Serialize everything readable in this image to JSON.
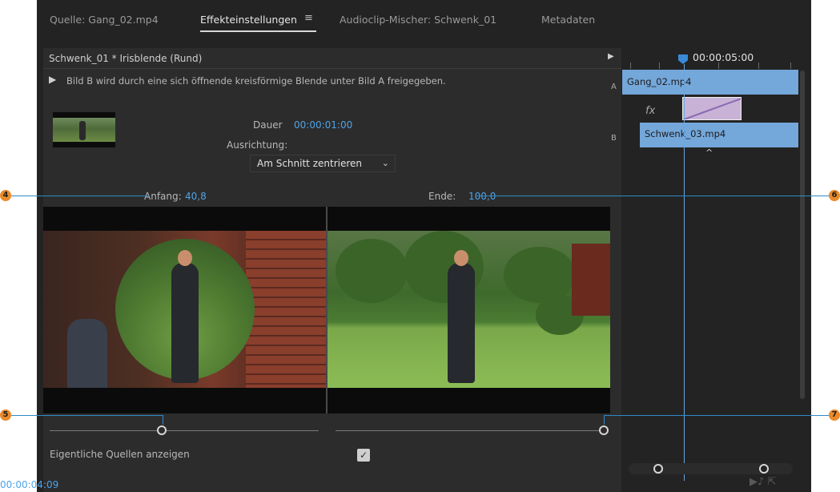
{
  "tabs": [
    {
      "label": "Quelle: Gang_02.mp4",
      "active": false
    },
    {
      "label": "Effekteinstellungen",
      "active": true
    },
    {
      "label": "Audioclip-Mischer: Schwenk_01",
      "active": false
    },
    {
      "label": "Metadaten",
      "active": false
    }
  ],
  "menu_icon": "≡",
  "effect": {
    "title": "Schwenk_01 * Irisblende (Rund)",
    "description": "Bild B wird durch eine sich öffnende kreisförmige Blende unter Bild A freigegeben.",
    "dauer_label": "Dauer",
    "dauer_value": "00:00:01:00",
    "ausrichtung_label": "Ausrichtung:",
    "ausrichtung_value": "Am Schnitt zentrieren",
    "anfang_label": "Anfang:",
    "anfang_value": "40,8",
    "ende_label": "Ende:",
    "ende_value": "100,0",
    "show_sources_label": "Eigentliche Quellen anzeigen",
    "show_sources_checked": true
  },
  "timeline": {
    "timecode": "00:00:05:00",
    "track_a": "A",
    "track_b": "B",
    "clip_a": "Gang_02.mp4",
    "clip_b": "Schwenk_03.mp4",
    "fx_label": "fx"
  },
  "bottom_timecode": "00:00:04:09",
  "callouts": [
    "4",
    "5",
    "6",
    "7"
  ],
  "icons": {
    "play": "play-icon",
    "arrow_right": "chevron-right-icon",
    "dropdown": "chevron-down-icon",
    "checkmark": "checkmark-icon",
    "caret": "caret-up-icon"
  },
  "colors": {
    "accent_blue": "#4ea3e8",
    "clip_blue": "#74a7da",
    "transition_purple": "#c8b2d6",
    "callout_orange": "#ea8a2a",
    "callout_line": "#2f8ac7",
    "panel_bg": "#232323"
  }
}
